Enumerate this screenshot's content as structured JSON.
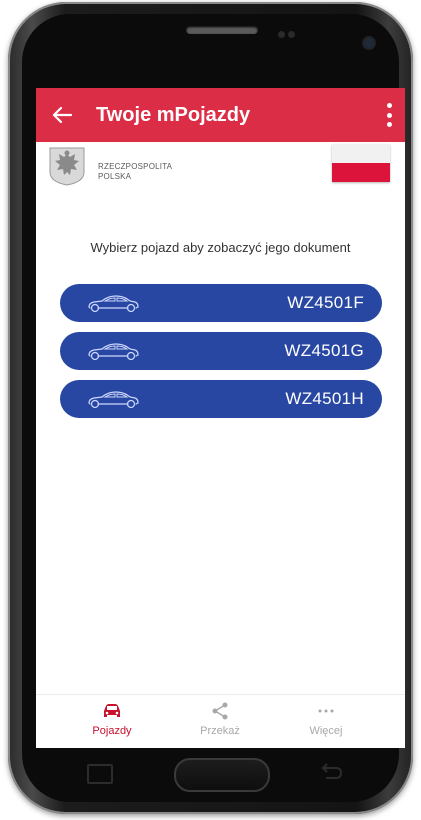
{
  "appbar": {
    "title": "Twoje mPojazdy",
    "back_icon": "arrow-left-icon",
    "menu_icon": "more-vertical-icon",
    "color": "#dc2d46"
  },
  "header": {
    "gov_line1": "RZECZPOSPOLITA",
    "gov_line2": "POLSKA",
    "emblem_icon": "polish-eagle-emblem",
    "flag_icon": "polish-flag"
  },
  "main": {
    "prompt": "Wybierz pojazd aby zobaczyć jego dokument",
    "vehicle_icon": "car-outline-icon",
    "button_color": "#2847a2",
    "vehicles": [
      {
        "plate": "WZ4501F"
      },
      {
        "plate": "WZ4501G"
      },
      {
        "plate": "WZ4501H"
      }
    ]
  },
  "bottom_nav": {
    "items": [
      {
        "label": "Pojazdy",
        "icon": "car-icon",
        "active": true
      },
      {
        "label": "Przekaż",
        "icon": "share-icon",
        "active": false
      },
      {
        "label": "Więcej",
        "icon": "more-horizontal-icon",
        "active": false
      }
    ],
    "active_color": "#c8102e",
    "inactive_color": "#a8a8a8"
  }
}
